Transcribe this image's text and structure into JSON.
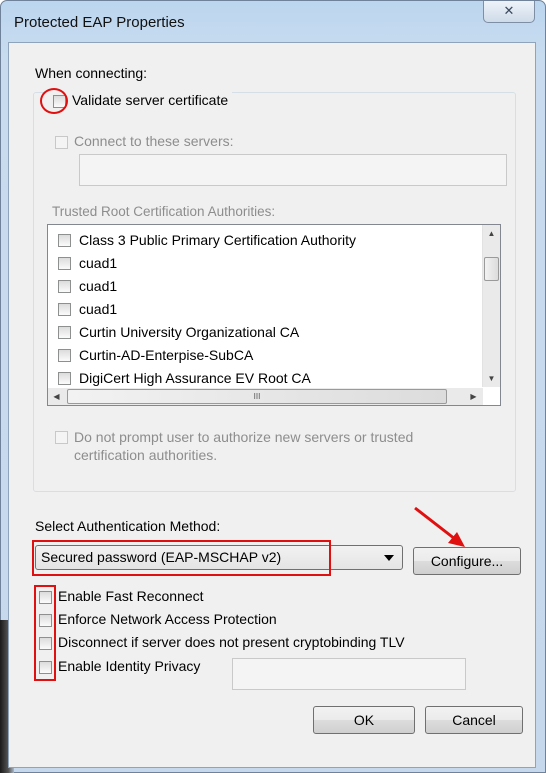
{
  "window": {
    "title": "Protected EAP Properties",
    "close_glyph": "✕"
  },
  "when_connecting": "When connecting:",
  "validate_server_certificate": "Validate server certificate",
  "connect_to_servers": {
    "label": "Connect to these servers:",
    "value": ""
  },
  "trusted_root_label": "Trusted Root Certification Authorities:",
  "trusted_root_list": [
    "Class 3 Public Primary Certification Authority",
    "cuad1",
    "cuad1",
    "cuad1",
    "Curtin University Organizational CA",
    "Curtin-AD-Enterpise-SubCA",
    "DigiCert High Assurance EV Root CA"
  ],
  "scroll_glyphs": {
    "up": "▲",
    "down": "▼",
    "left": "◀",
    "right": "▶",
    "grip": "III"
  },
  "do_not_prompt": "Do not prompt user to authorize new servers or trusted certification authorities.",
  "select_auth_label": "Select Authentication Method:",
  "auth_method": {
    "selected": "Secured password (EAP-MSCHAP v2)"
  },
  "configure_label": "Configure...",
  "options": [
    "Enable Fast Reconnect",
    "Enforce Network Access Protection",
    "Disconnect if server does not present cryptobinding TLV",
    "Enable Identity Privacy"
  ],
  "identity_privacy_value": "",
  "ok_label": "OK",
  "cancel_label": "Cancel",
  "annotation_color": "#e01010"
}
